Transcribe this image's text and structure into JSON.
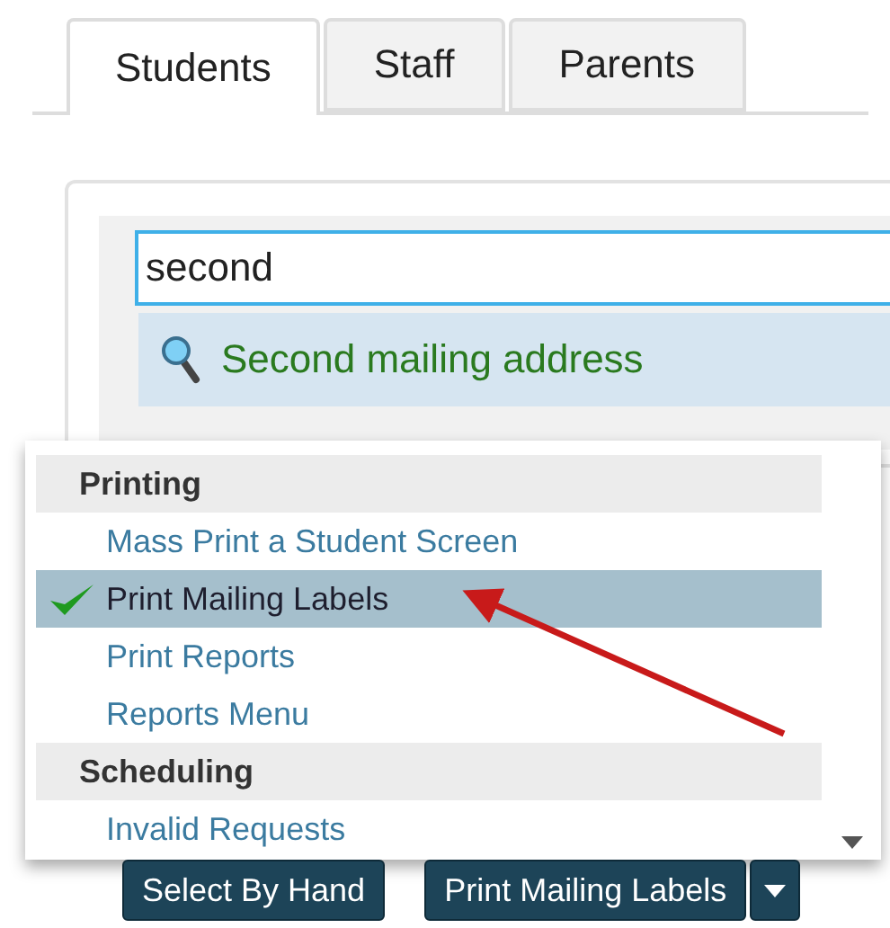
{
  "tabs": [
    {
      "label": "Students",
      "selected": true
    },
    {
      "label": "Staff",
      "selected": false
    },
    {
      "label": "Parents",
      "selected": false
    }
  ],
  "search": {
    "value": "second",
    "suggestions": [
      {
        "label": "Second mailing address",
        "highlighted": true
      }
    ]
  },
  "menu": {
    "items": [
      {
        "kind": "header",
        "label": "Printing"
      },
      {
        "kind": "item",
        "label": "Mass Print a Student Screen",
        "selected": false
      },
      {
        "kind": "item",
        "label": "Print Mailing Labels",
        "selected": true
      },
      {
        "kind": "item",
        "label": "Print Reports",
        "selected": false
      },
      {
        "kind": "item",
        "label": "Reports Menu",
        "selected": false
      },
      {
        "kind": "header",
        "label": "Scheduling"
      },
      {
        "kind": "item",
        "label": "Invalid Requests",
        "selected": false
      }
    ]
  },
  "buttons": [
    {
      "kind": "plain",
      "label": "Select By Hand"
    },
    {
      "kind": "split",
      "label": "Print Mailing Labels"
    }
  ]
}
